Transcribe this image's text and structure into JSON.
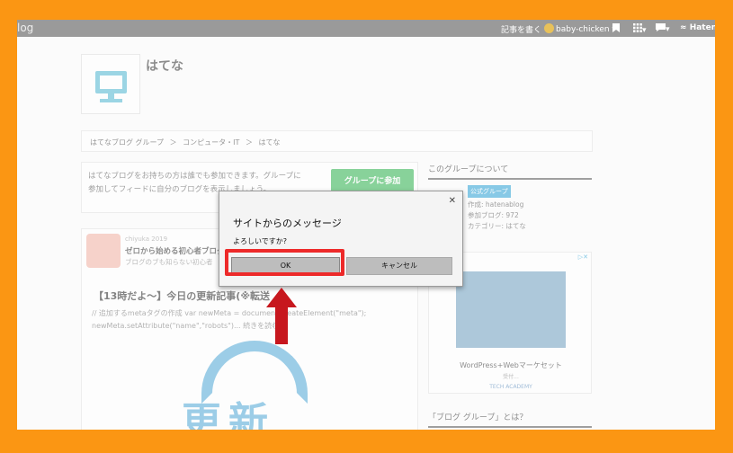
{
  "topbar": {
    "brand": "log",
    "write_label": "記事を書く",
    "user": "baby-chicken",
    "user_caret": "▾",
    "menu_caret": "▾",
    "hatena_logo": "Haten"
  },
  "header": {
    "title": "はてな"
  },
  "breadcrumb": {
    "items": [
      "はてなブログ グループ",
      "＞",
      "コンピュータ・IT",
      "＞",
      "はてな"
    ]
  },
  "join": {
    "text": "はてなブログをお持ちの方は誰でも参加できます。グループに参加してフィードに自分のブログを表示しましょう。",
    "button": "グループに参加"
  },
  "entry": {
    "meta": "chiyuka 2019",
    "blog_title": "ゼロから始める初心者ブログ",
    "blog_desc": "ブログのブも知らない初心者",
    "title": "【13時だよ〜】今日の更新記事(※転送",
    "snippet": "// 追加するmetaタグの作成 var newMeta = document.createElement(\"meta\"); newMeta.setAttribute(\"name\",\"robots\")... 続きを読む",
    "image_text": "更新"
  },
  "sidebar": {
    "about_heading": "このグループについて",
    "badge": "公式グループ",
    "author": "作成: hatenablog",
    "members": "参加ブログ: 972",
    "category": "カテゴリー: はてな",
    "ad_title": "WordPress+Webマーケセット",
    "ad_dots": "受付...",
    "ad_sponsor": "TECH ACADEMY",
    "ad_badge": "▷✕",
    "group_heading": "「ブログ グループ」とは？"
  },
  "dialog": {
    "close": "✕",
    "title": "サイトからのメッセージ",
    "message": "よろしいですか?",
    "ok_label": "OK",
    "cancel_label": "キャンセル"
  },
  "colors": {
    "border_orange": "#fb9613",
    "highlight_red": "#ed2a2a",
    "arrow_red": "#c7171e",
    "topbar_gray": "#9a9a9a"
  }
}
